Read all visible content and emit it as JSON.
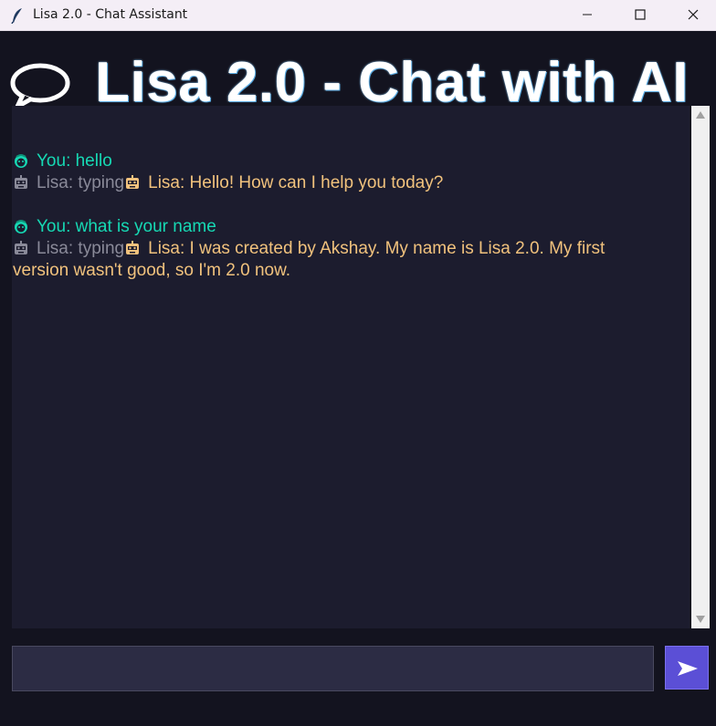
{
  "window": {
    "title": "Lisa 2.0 - Chat Assistant",
    "icon": "feather-icon"
  },
  "header": {
    "title": "Lisa 2.0 - Chat with AI",
    "icon": "speech-bubble-icon"
  },
  "chat": {
    "messages": [
      {
        "sender": "you",
        "icon": "user-emoji-icon",
        "text": "You: hello"
      },
      {
        "sender": "typing",
        "icon": "robot-emoji-icon",
        "text": "Lisa: typing"
      },
      {
        "sender": "lisa",
        "icon": "robot-emoji-icon",
        "text": "Lisa: Hello! How can I help you today?"
      },
      {
        "sender": "you",
        "icon": "user-emoji-icon",
        "text": "You: what is your name"
      },
      {
        "sender": "typing",
        "icon": "robot-emoji-icon",
        "text": "Lisa: typing"
      },
      {
        "sender": "lisa",
        "icon": "robot-emoji-icon",
        "text": "Lisa: I was created by Akshay. My name is Lisa 2.0. My first"
      },
      {
        "sender": "lisa",
        "icon": "",
        "text": "version wasn't good, so I'm 2.0 now."
      }
    ]
  },
  "input": {
    "value": "",
    "placeholder": ""
  },
  "send": {
    "icon": "send-arrow-icon"
  },
  "colors": {
    "background": "#13131f",
    "chat_background": "#1c1c2e",
    "user_text": "#16d9b4",
    "bot_text": "#f1c27d",
    "typing_text": "#8a8a99",
    "send_button": "#5b4fd6"
  }
}
